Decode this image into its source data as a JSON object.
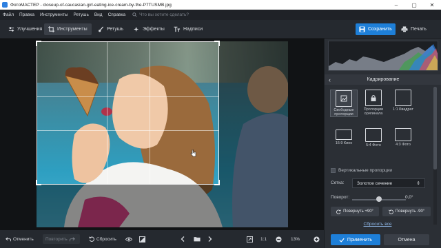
{
  "app": {
    "title": "ФотоМАСТЕР - closeup-of-caucasian-girl-eating-ice-cream-by-the-P7TUSMB.jpg",
    "window_controls": [
      "–",
      "▢",
      "✕"
    ]
  },
  "menu": {
    "items": [
      "Файл",
      "Правка",
      "Инструменты",
      "Ретушь",
      "Вид",
      "Справка"
    ],
    "search_placeholder": "Что вы хотите сделать?"
  },
  "toolbar": {
    "tabs": [
      {
        "label": "Улучшения",
        "icon": "sliders-icon"
      },
      {
        "label": "Инструменты",
        "icon": "crop-icon",
        "active": true
      },
      {
        "label": "Ретушь",
        "icon": "brush-icon"
      },
      {
        "label": "Эффекты",
        "icon": "sparkles-icon"
      },
      {
        "label": "Надписи",
        "icon": "text-icon"
      }
    ],
    "save_label": "Сохранить",
    "print_label": "Печать"
  },
  "bottom": {
    "undo_label": "Отменить",
    "redo_label": "Повторить",
    "reset_label": "Сбросить",
    "zoom_ratio": "1:1",
    "zoom_value": "13%"
  },
  "panel": {
    "section_title": "Кадрирование",
    "presets": [
      {
        "label": "Свободные пропорции",
        "icon": "crop-free-icon",
        "selected": true
      },
      {
        "label": "Пропорции оригинала",
        "icon": "lock-aspect-icon"
      },
      {
        "label": "1:1 Квадрат",
        "icon": "square-icon"
      },
      {
        "label": "16:9 Кино",
        "icon": "wide-rect-icon"
      },
      {
        "label": "5:4 Фото",
        "icon": "rect-icon"
      },
      {
        "label": "4:3 Фото",
        "icon": "rect-icon"
      }
    ],
    "vertical_label": "Вертикальные пропорции",
    "grid_label": "Сетка:",
    "grid_value": "Золотое сечение",
    "rotation_label": "Поворот:",
    "rotation_value": "0,0°",
    "rotation_fraction": 0.5,
    "rotate_plus_label": "Повернуть +90°",
    "rotate_minus_label": "Повернуть -90°",
    "reset_all_label": "Сбросить все",
    "apply_label": "Применить",
    "cancel_label": "Отмена"
  },
  "colors": {
    "accent": "#1e7fd8",
    "panel_bg": "#2b2f35",
    "toolbar_bg": "#25292f"
  }
}
